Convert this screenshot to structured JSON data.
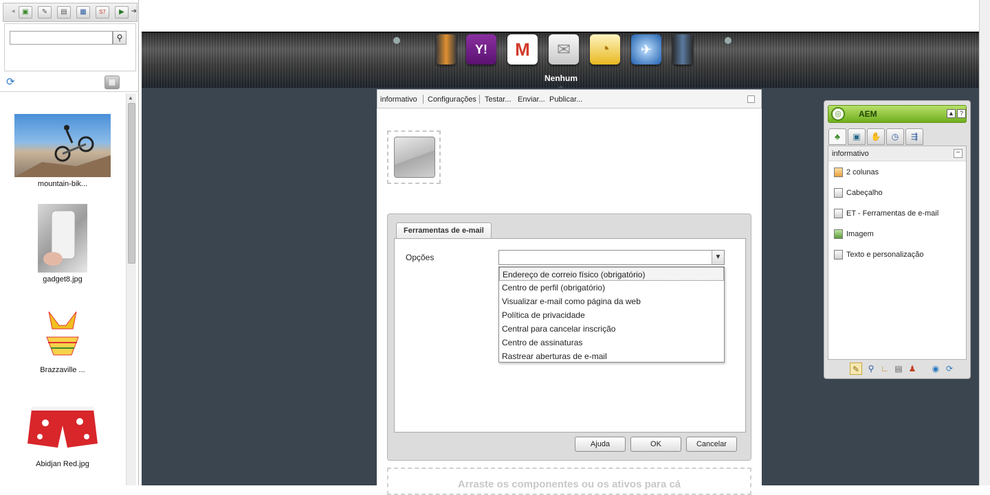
{
  "left_panel": {
    "toolbar_icons": [
      "images-icon",
      "documents-icon",
      "pages-icon",
      "paragraphs-icon",
      "s7-icon",
      "movies-icon"
    ],
    "search": {
      "value": "",
      "placeholder": ""
    },
    "assets": [
      {
        "label": "mountain-bik..."
      },
      {
        "label": "gadget8.jpg"
      },
      {
        "label": "Brazzaville ..."
      },
      {
        "label": "Abidjan Red.jpg"
      }
    ]
  },
  "emulator": {
    "clients": [
      "generic-client-icon",
      "yahoo-mail-icon",
      "gmail-icon",
      "generic-mail-icon",
      "outlook-icon",
      "thunderbird-icon",
      "user-icon"
    ],
    "yahoo_text": "Y!",
    "gmail_text": "M",
    "selected_label": "Nenhum"
  },
  "page_toolbar": {
    "items": [
      "informativo",
      "Configurações",
      "Testar...",
      "Enviar...",
      "Publicar..."
    ]
  },
  "drop_zone_text": "Arraste os componentes ou os ativos para cá",
  "dialog": {
    "tab_label": "Ferramentas de e-mail",
    "field_label": "Opções",
    "select_value": "",
    "options": [
      "Endereço de correio físico (obrigatório)",
      "Centro de perfil (obrigatório)",
      "Visualizar e-mail como página da web",
      "Política de privacidade",
      "Central para cancelar inscrição",
      "Centro de assinaturas",
      "Rastrear aberturas de e-mail"
    ],
    "buttons": {
      "help": "Ajuda",
      "ok": "OK",
      "cancel": "Cancelar"
    }
  },
  "sidekick": {
    "title": "AEM",
    "group_label": "informativo",
    "components": [
      "2 colunas",
      "Cabeçalho",
      "ET - Ferramentas de e-mail",
      "Imagem",
      "Texto e personalização"
    ],
    "header_buttons": [
      "▲",
      "?"
    ],
    "accent": "#7bbf2a"
  }
}
